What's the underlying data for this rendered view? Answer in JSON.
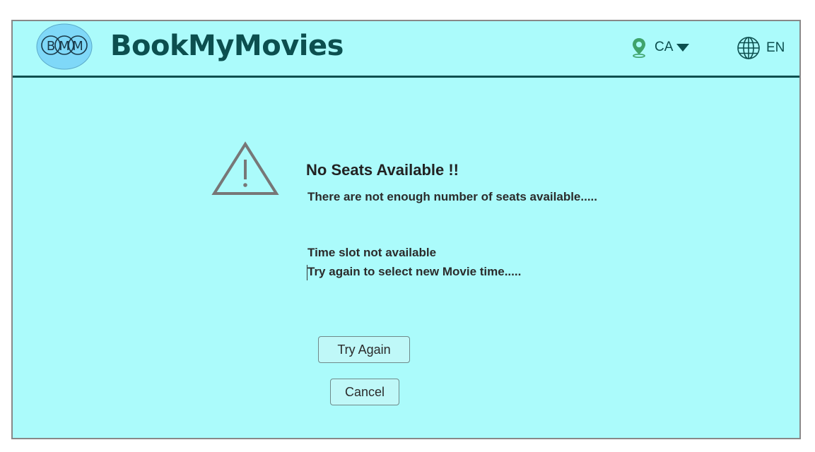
{
  "header": {
    "logo_letters": [
      "B",
      "M",
      "M"
    ],
    "brand": "BookMyMovies",
    "region": {
      "icon": "location-pin-icon",
      "code": "CA",
      "dropdown_icon": "caret-down-icon"
    },
    "language": {
      "icon": "globe-icon",
      "code": "EN"
    }
  },
  "dialog": {
    "icon": "warning-triangle-icon",
    "title": "No Seats Available !!",
    "message1": "There are not enough number of seats available.....",
    "message2": "Time slot not available",
    "message3": "Try again to select new Movie time....."
  },
  "actions": {
    "try_again": "Try Again",
    "cancel": "Cancel"
  },
  "colors": {
    "background": "#abfbfb",
    "brand": "#0c4f4f",
    "logo_fill": "#7fd8f8",
    "button_bg": "#bff8f8",
    "icon_gray": "#777777",
    "pin_green": "#3fa36b"
  }
}
